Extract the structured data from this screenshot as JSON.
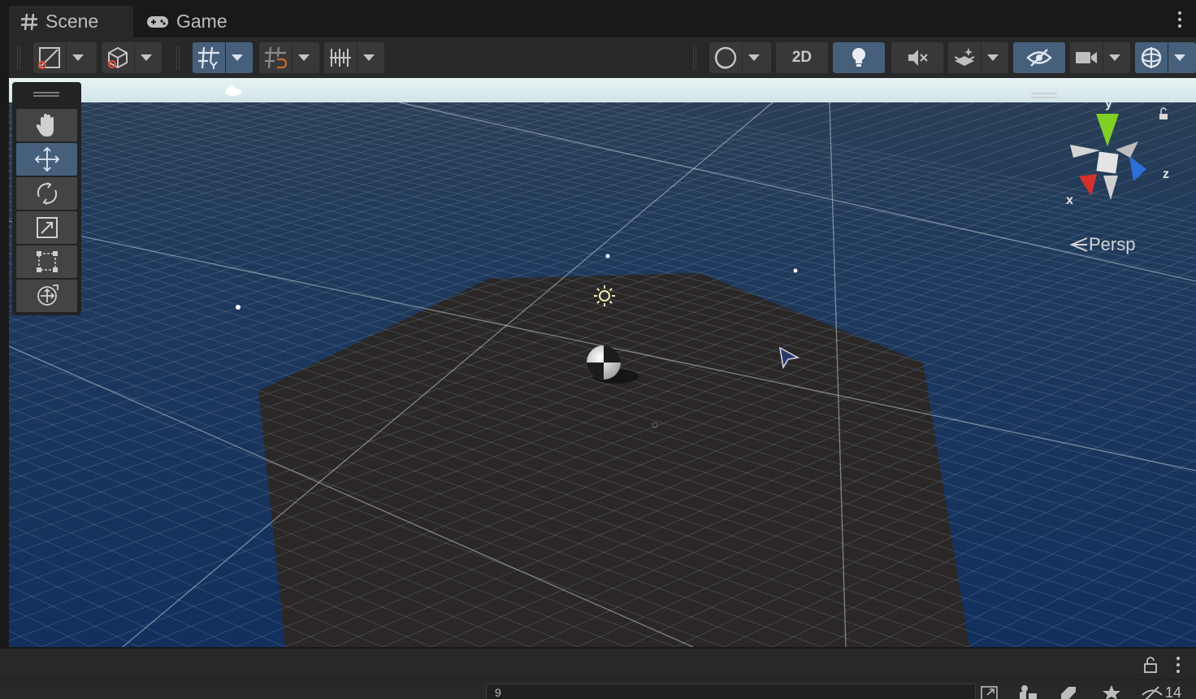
{
  "tabs": [
    {
      "label": "Scene",
      "icon": "hash-icon",
      "active": true
    },
    {
      "label": "Game",
      "icon": "gamepad-icon",
      "active": false
    }
  ],
  "toolbar": {
    "mode_2d_label": "2D"
  },
  "tools": [
    {
      "name": "hand-tool",
      "icon": "hand-icon",
      "active": false
    },
    {
      "name": "move-tool",
      "icon": "move-icon",
      "active": true
    },
    {
      "name": "rotate-tool",
      "icon": "rotate-icon",
      "active": false
    },
    {
      "name": "scale-tool",
      "icon": "scale-icon",
      "active": false
    },
    {
      "name": "rect-tool",
      "icon": "rect-icon",
      "active": false
    },
    {
      "name": "transform-tool",
      "icon": "transform-icon",
      "active": false
    }
  ],
  "gizmo": {
    "x_label": "x",
    "y_label": "y",
    "z_label": "z",
    "projection_label": "Persp"
  },
  "colors": {
    "accent": "#46607c",
    "axis_x": "#d6302a",
    "axis_y": "#7fcf24",
    "axis_z": "#2c6fd9",
    "sky": "#dcecef"
  },
  "bottom": {
    "search_value": "9",
    "hidden_count": "14"
  }
}
